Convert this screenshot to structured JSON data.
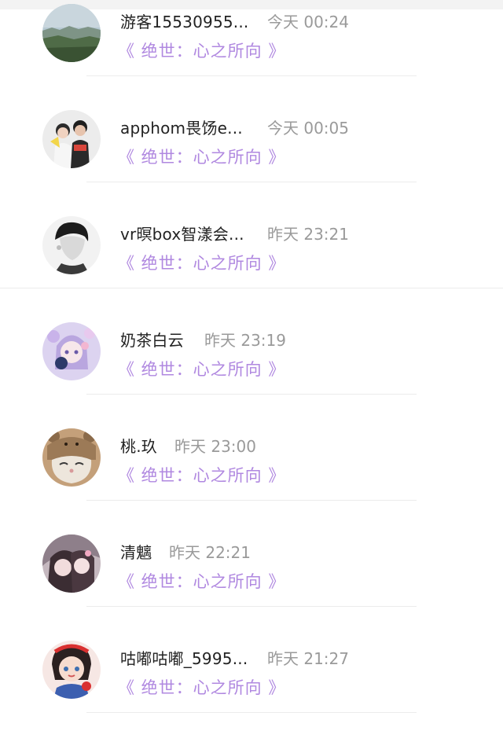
{
  "comments": [
    {
      "name": "游客15530955...",
      "time": "今天 00:24",
      "work": "《 绝世：心之所向 》",
      "avatar": "landscape-avatar"
    },
    {
      "name": "apphom畏饧e...",
      "time": "今天 00:05",
      "work": "《 绝世：心之所向 》",
      "avatar": "couple-avatar"
    },
    {
      "name": "vr暝box智漾会...",
      "time": "昨天 23:21",
      "work": "《 绝世：心之所向 》",
      "avatar": "man-portrait-avatar"
    },
    {
      "name": "奶茶白云",
      "time": "昨天 23:19",
      "work": "《 绝世：心之所向 》",
      "avatar": "anime-girl-avatar"
    },
    {
      "name": "桃.玖",
      "time": "昨天 23:00",
      "work": "《 绝世：心之所向 》",
      "avatar": "cat-avatar"
    },
    {
      "name": "清魑",
      "time": "昨天 22:21",
      "work": "《 绝世：心之所向 》",
      "avatar": "girls-photo-avatar"
    },
    {
      "name": "咕嘟咕嘟_5995...",
      "time": "昨天 21:27",
      "work": "《 绝世：心之所向 》",
      "avatar": "snow-white-avatar"
    }
  ],
  "colors": {
    "work_link": "#b088e0",
    "name": "#222222",
    "time": "#9a9a9a"
  }
}
